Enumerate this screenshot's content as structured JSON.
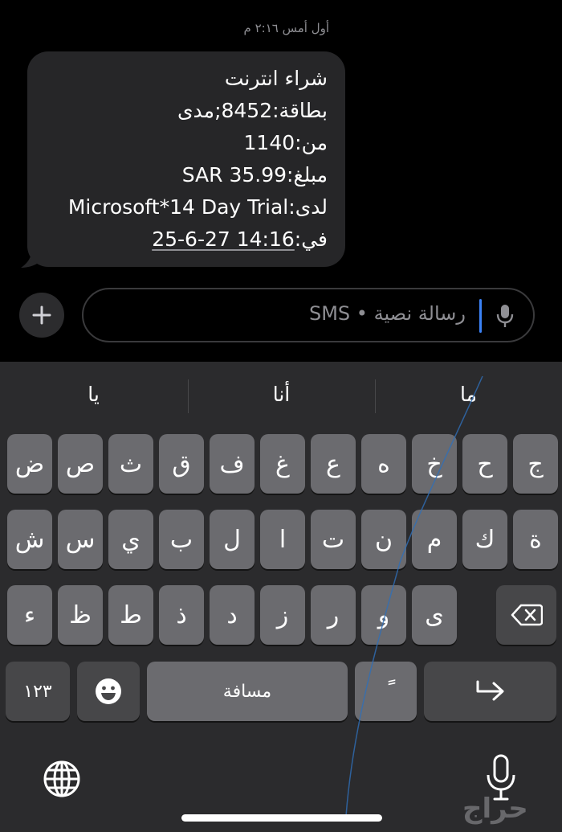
{
  "conversation": {
    "timestamp": "أول أمس ٢:١٦ م",
    "message_lines": [
      "شراء انترنت",
      "بطاقة:8452;مدى",
      "من:1140",
      "مبلغ:SAR 35.99",
      "لدى:Microsoft*14 Day Trial",
      "في:"
    ],
    "message_link": "25-6-27 14:16"
  },
  "composer": {
    "placeholder": "رسالة نصية • SMS",
    "icons": {
      "plus": "plus-icon",
      "mic": "microphone-icon"
    }
  },
  "keyboard": {
    "suggestions": [
      "ما",
      "أنا",
      "يا"
    ],
    "row1": [
      "ج",
      "ح",
      "خ",
      "ه",
      "ع",
      "غ",
      "ف",
      "ق",
      "ث",
      "ص",
      "ض"
    ],
    "row2": [
      "ة",
      "ك",
      "م",
      "ن",
      "ت",
      "ا",
      "ل",
      "ب",
      "ي",
      "س",
      "ش"
    ],
    "row3": [
      "ى",
      "و",
      "ر",
      "ز",
      "د",
      "ذ",
      "ط",
      "ظ",
      "ء"
    ],
    "numbers_label": "١٢٣",
    "space_label": "مسافة",
    "tanween_label": "ً",
    "icons": {
      "delete": "delete-backspace-icon",
      "emoji": "emoji-icon",
      "return": "return-arrow-icon",
      "globe": "globe-icon",
      "dictation": "microphone-icon"
    }
  },
  "watermark": "حراج",
  "colors": {
    "bubble": "#262628",
    "keyboard": "#2b2b2d",
    "key": "#6b6b6f",
    "caret": "#3b82f6"
  }
}
